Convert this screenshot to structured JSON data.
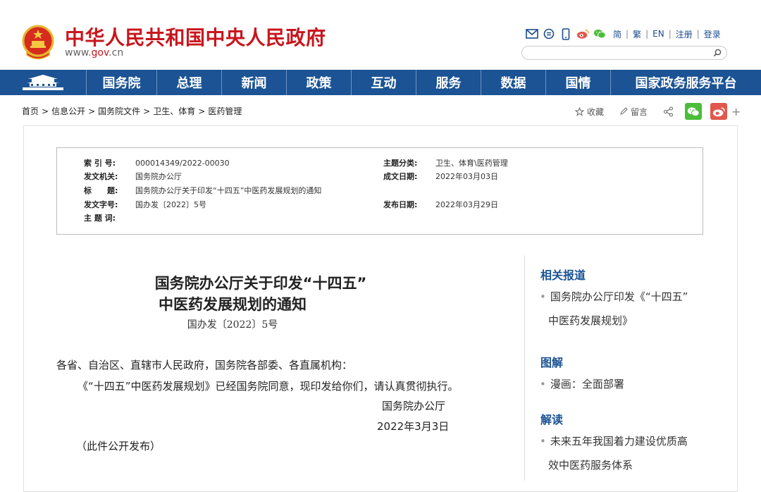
{
  "header": {
    "site_title": "中华人民共和国中央人民政府",
    "domain_prefix": "www.",
    "domain_mid": "gov",
    "domain_suffix": ".cn",
    "links": [
      "简",
      "繁",
      "EN",
      "注册",
      "登录"
    ],
    "icons": [
      "mail-icon",
      "message-icon",
      "mobile-icon",
      "weibo-icon",
      "wechat-icon"
    ],
    "search_placeholder": ""
  },
  "nav": {
    "items": [
      "国务院",
      "总理",
      "新闻",
      "政策",
      "互动",
      "服务",
      "数据",
      "国情",
      "国家政务服务平台"
    ]
  },
  "breadcrumb": {
    "items": [
      "首页",
      "信息公开",
      "国务院文件",
      "卫生、体育",
      "医药管理"
    ],
    "separator": ">"
  },
  "tools": {
    "favorite": "收藏",
    "comment": "留言",
    "plus": "+"
  },
  "info": {
    "index_label": "索 引 号:",
    "index_value": "000014349/2022-00030",
    "topic_label": "主题分类:",
    "topic_value": "卫生、体育\\医药管理",
    "issuer_label": "发文机关:",
    "issuer_value": "国务院办公厅",
    "date_written_label": "成文日期:",
    "date_written_value": "2022年03月03日",
    "title_label": "标　　题:",
    "title_value": "国务院办公厅关于印发“十四五”中医药发展规划的通知",
    "docno_label": "发文字号:",
    "docno_value": "国办发〔2022〕5号",
    "pub_date_label": "发布日期:",
    "pub_date_value": "2022年03月29日",
    "keywords_label": "主 题 词:"
  },
  "article": {
    "title_line1": "国务院办公厅关于印发“十四五”",
    "title_line2": "中医药发展规划的通知",
    "doc_number": "国办发〔2022〕5号",
    "salutation": "各省、自治区、直辖市人民政府，国务院各部委、各直属机构：",
    "body": "《“十四五”中医药发展规划》已经国务院同意，现印发给你们，请认真贯彻执行。",
    "signer": "国务院办公厅",
    "date": "2022年3月3日",
    "note": "（此件公开发布）"
  },
  "sidebar": {
    "related_heading": "相关报道",
    "related_line1": "国务院办公厅印发《“十四五”",
    "related_line2": "中医药发展规划》",
    "graphic_heading": "图解",
    "graphic_item": "漫画：全面部署",
    "interpret_heading": "解读",
    "interpret_line1": "未来五年我国着力建设优质高",
    "interpret_line2": "效中医药服务体系",
    "bullet": "•"
  },
  "colors": {
    "brand_red": "#c8161d",
    "nav_blue": "#1b5394",
    "wechat_green": "#4bbd3a",
    "weibo_red": "#e2574c"
  }
}
